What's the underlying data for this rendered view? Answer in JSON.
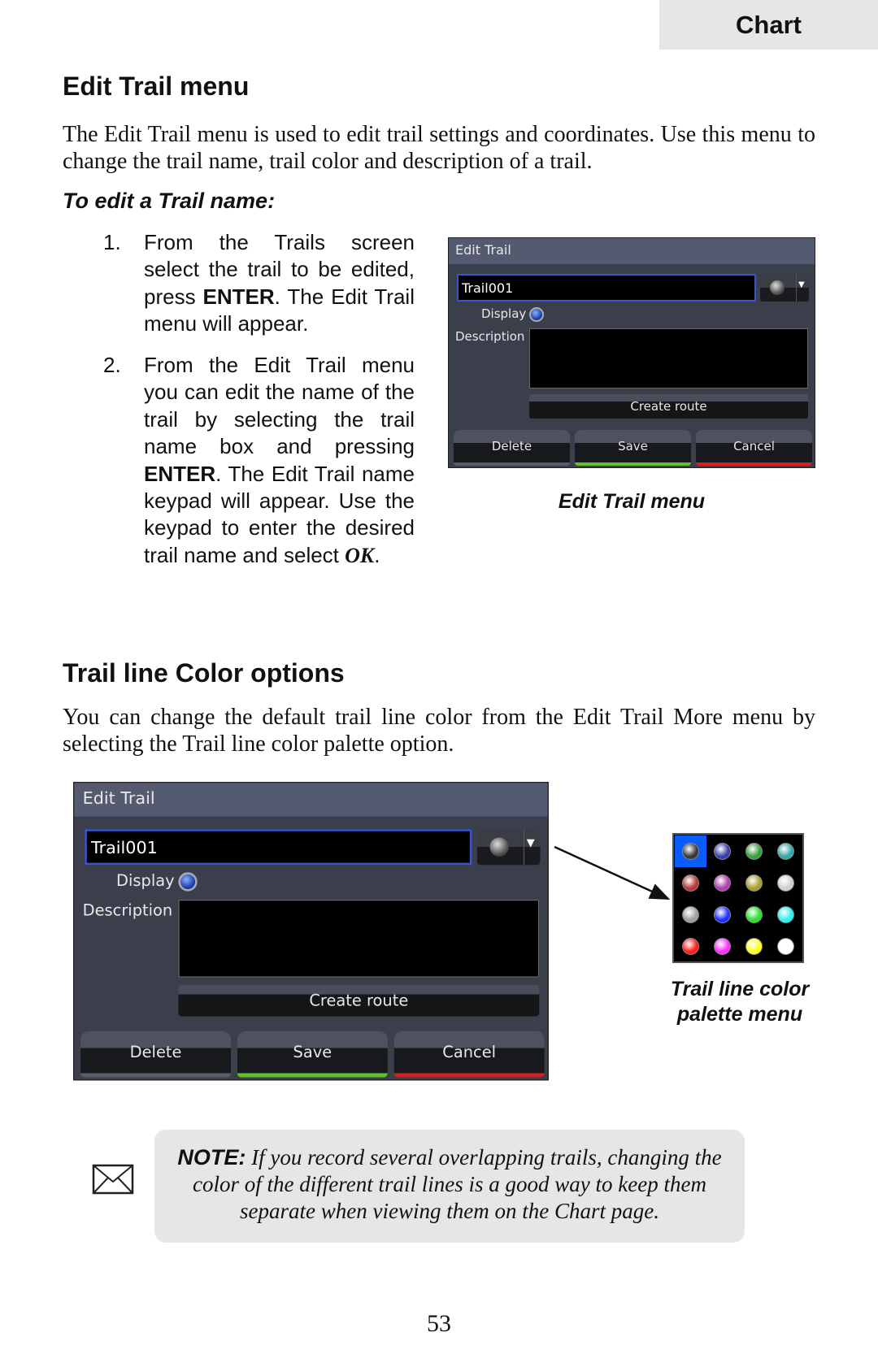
{
  "header_tab": "Chart",
  "section1": {
    "title": "Edit Trail menu",
    "paragraph": "The Edit Trail menu is used to edit trail settings and coordinates. Use this menu to change the trail name, trail color and description of a trail.",
    "subheading": "To edit a Trail name:",
    "steps": [
      {
        "num": "1.",
        "pre": "From the Trails screen select the trail to be edited, press ",
        "bold": "ENTER",
        "post": ". The Edit Trail menu will appear."
      },
      {
        "num": "2.",
        "pre": "From the Edit Trail menu you can edit the name of the trail by selecting the trail name box and pressing ",
        "bold": "ENTER",
        "mid": ". The Edit Trail name keypad will appear. Use the keypad to enter the desired trail name and select ",
        "ok": "OK",
        "post": "."
      }
    ],
    "caption": "Edit Trail menu"
  },
  "dialog": {
    "title": "Edit Trail",
    "name_value": "Trail001",
    "display_label": "Display",
    "description_label": "Description",
    "create_route": "Create route",
    "delete": "Delete",
    "save": "Save",
    "cancel": "Cancel",
    "save_accent": "#5ec02a",
    "cancel_accent": "#d42020"
  },
  "section2": {
    "title": "Trail line Color options",
    "paragraph": "You can change the default trail line color from the Edit Trail More menu by selecting the Trail line color palette option.",
    "caption_line1": "Trail line color",
    "caption_line2": "palette menu"
  },
  "palette": {
    "selected_index": 0,
    "selection_color": "#0a5cff",
    "colors": [
      "#3a3a3a",
      "#3a3fa8",
      "#3aa040",
      "#3aa8a8",
      "#b83a3a",
      "#b040b0",
      "#a8a030",
      "#d0d0d0",
      "#a0a0a0",
      "#2030ff",
      "#30e030",
      "#30f0f0",
      "#ff2020",
      "#ff30ff",
      "#ffff20",
      "#ffffff"
    ]
  },
  "note": {
    "label": "NOTE:",
    "text": " If you record several overlapping trails, changing the color of the different trail lines is a good way to keep them separate when viewing them on the Chart page."
  },
  "page_number": "53"
}
